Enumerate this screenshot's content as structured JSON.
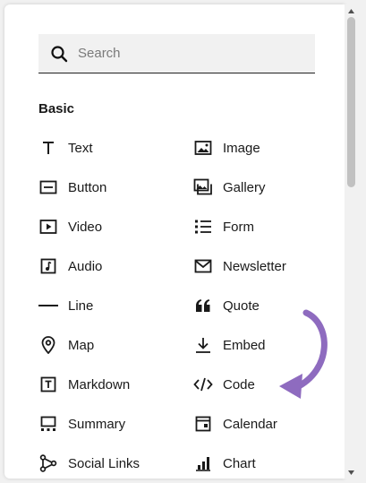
{
  "search": {
    "placeholder": "Search"
  },
  "section": {
    "title": "Basic"
  },
  "blocks": [
    {
      "label": "Text",
      "icon": "text-icon"
    },
    {
      "label": "Image",
      "icon": "image-icon"
    },
    {
      "label": "Button",
      "icon": "button-icon"
    },
    {
      "label": "Gallery",
      "icon": "gallery-icon"
    },
    {
      "label": "Video",
      "icon": "video-icon"
    },
    {
      "label": "Form",
      "icon": "form-icon"
    },
    {
      "label": "Audio",
      "icon": "audio-icon"
    },
    {
      "label": "Newsletter",
      "icon": "newsletter-icon"
    },
    {
      "label": "Line",
      "icon": "line-icon"
    },
    {
      "label": "Quote",
      "icon": "quote-icon"
    },
    {
      "label": "Map",
      "icon": "map-pin-icon"
    },
    {
      "label": "Embed",
      "icon": "embed-icon"
    },
    {
      "label": "Markdown",
      "icon": "markdown-icon"
    },
    {
      "label": "Code",
      "icon": "code-icon"
    },
    {
      "label": "Summary",
      "icon": "summary-icon"
    },
    {
      "label": "Calendar",
      "icon": "calendar-icon"
    },
    {
      "label": "Social Links",
      "icon": "social-links-icon"
    },
    {
      "label": "Chart",
      "icon": "chart-icon"
    }
  ],
  "colors": {
    "accent_arrow": "#8e6bbf",
    "icon": "#1a1a1a"
  }
}
